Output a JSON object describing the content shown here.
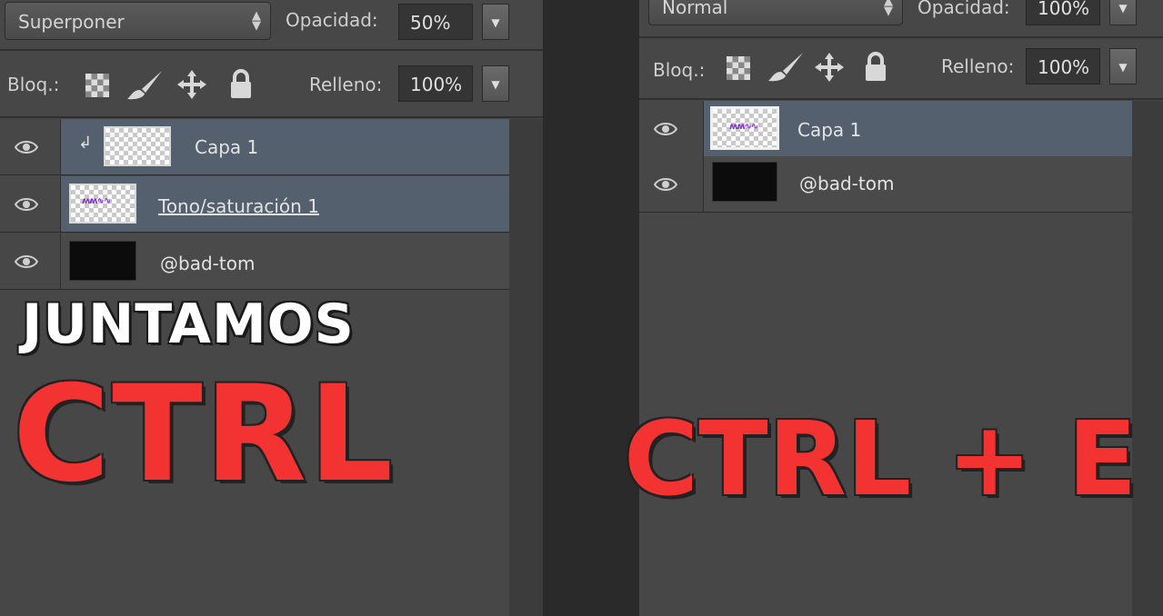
{
  "left": {
    "blend_mode": "Superponer",
    "opacity_label": "Opacidad:",
    "opacity_value": "50%",
    "lock_label": "Bloq.:",
    "fill_label": "Relleno:",
    "fill_value": "100%",
    "layers": [
      {
        "name": "Capa 1",
        "selected": true,
        "clipped": true,
        "thumb": "transparent"
      },
      {
        "name": "Tono/saturación 1",
        "selected": true,
        "clipped": false,
        "thumb": "adjustment"
      },
      {
        "name": "@bad-tom",
        "selected": false,
        "clipped": false,
        "thumb": "black"
      }
    ]
  },
  "right": {
    "blend_mode": "Normal",
    "opacity_label": "Opacidad:",
    "opacity_value": "100%",
    "lock_label": "Bloq.:",
    "fill_label": "Relleno:",
    "fill_value": "100%",
    "layers": [
      {
        "name": "Capa 1",
        "selected": true,
        "thumb": "transparent-with-text"
      },
      {
        "name": "@bad-tom",
        "selected": false,
        "thumb": "black"
      }
    ]
  },
  "overlay": {
    "line1": "JUNTAMOS",
    "line2": "CTRL",
    "right_text": "CTRL + E"
  },
  "colors": {
    "accent_red": "#f33232",
    "selected_layer": "#55606f",
    "panel_bg": "#474747"
  },
  "icons": [
    "eye-icon",
    "checkerboard-lock-icon",
    "brush-lock-icon",
    "move-lock-icon",
    "padlock-icon",
    "clip-arrow-icon"
  ]
}
